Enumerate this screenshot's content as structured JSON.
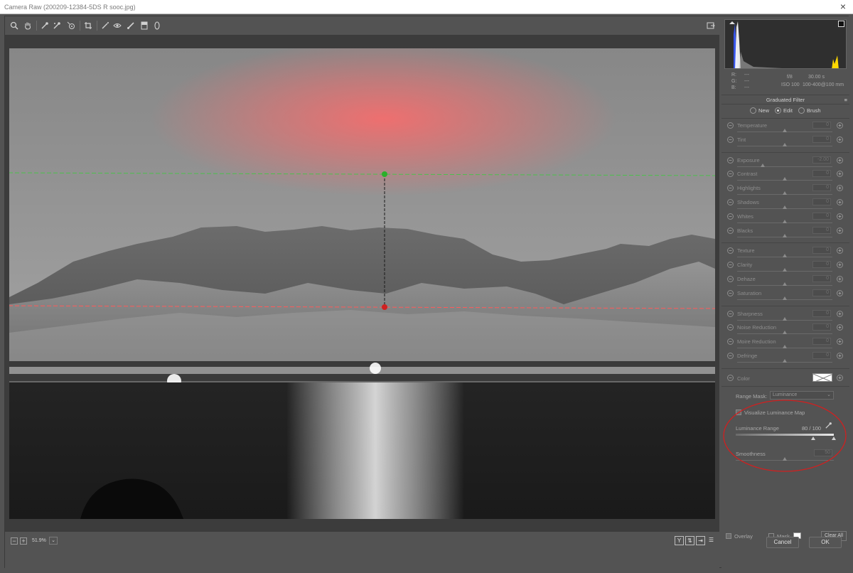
{
  "window": {
    "title": "Camera Raw (200209-12384-5DS R sooc.jpg)"
  },
  "toolbar": {
    "tools": [
      "zoom-icon",
      "hand-icon",
      "white-balance-icon",
      "color-sampler-icon",
      "targeted-adjustment-icon",
      "crop-icon",
      "straighten-icon",
      "transform-icon",
      "spot-removal-icon",
      "red-eye-icon",
      "adjustment-brush-icon",
      "graduated-filter-icon",
      "radial-filter-icon",
      "rotate-icon"
    ]
  },
  "info": {
    "r_label": "R:",
    "g_label": "G:",
    "b_label": "B:",
    "r_val": "---",
    "g_val": "---",
    "b_val": "---",
    "aperture": "f/8",
    "shutter": "30.00 s",
    "iso": "ISO 100",
    "lens": "100-400@100 mm"
  },
  "panel": {
    "title": "Graduated Filter",
    "mode_new": "New",
    "mode_edit": "Edit",
    "mode_brush": "Brush",
    "sliders": [
      {
        "label": "Temperature",
        "value": "0"
      },
      {
        "label": "Tint",
        "value": "0"
      },
      {
        "label": "Exposure",
        "value": "-2.00"
      },
      {
        "label": "Contrast",
        "value": "0"
      },
      {
        "label": "Highlights",
        "value": "0"
      },
      {
        "label": "Shadows",
        "value": "0"
      },
      {
        "label": "Whites",
        "value": "0"
      },
      {
        "label": "Blacks",
        "value": "0"
      },
      {
        "label": "Texture",
        "value": "0"
      },
      {
        "label": "Clarity",
        "value": "0"
      },
      {
        "label": "Dehaze",
        "value": "0"
      },
      {
        "label": "Saturation",
        "value": "0"
      },
      {
        "label": "Sharpness",
        "value": "0"
      },
      {
        "label": "Noise Reduction",
        "value": "0"
      },
      {
        "label": "Moire Reduction",
        "value": "0"
      },
      {
        "label": "Defringe",
        "value": "0"
      }
    ],
    "color_label": "Color",
    "range_mask_label": "Range Mask:",
    "range_mask_value": "Luminance",
    "visualize_label": "Visualize Luminance Map",
    "luminance_range_label": "Luminance Range",
    "luminance_range_value": "80 / 100",
    "smoothness_label": "Smoothness",
    "smoothness_value": "50",
    "overlay_label": "Overlay",
    "mask_label": "Mask",
    "clear_all_label": "Clear All"
  },
  "bottombar": {
    "zoom": "51.9%"
  },
  "dialog": {
    "cancel_label": "Cancel",
    "ok_label": "OK"
  },
  "colors": {
    "annotation_circle": "#d02020",
    "green_pin": "#2ab02a",
    "red_pin": "#d02020",
    "mask_overlay": "#ff4a4a"
  }
}
